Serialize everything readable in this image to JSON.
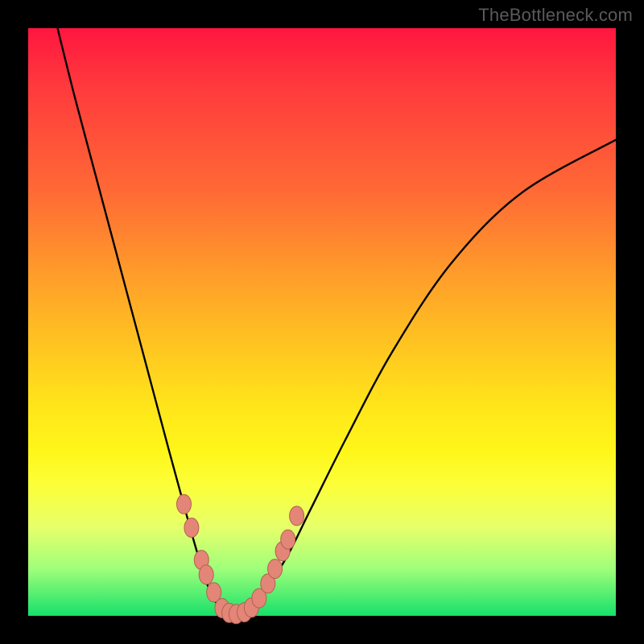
{
  "watermark": "TheBottleneck.com",
  "colors": {
    "frame_bg": "#000000",
    "curve_stroke": "#000000",
    "marker_fill": "#e38677",
    "marker_stroke": "#b45f52"
  },
  "chart_data": {
    "type": "line",
    "title": "",
    "xlabel": "",
    "ylabel": "",
    "xlim": [
      0,
      100
    ],
    "ylim": [
      0,
      100
    ],
    "series": [
      {
        "name": "bottleneck-curve",
        "x": [
          5,
          8,
          12,
          16,
          20,
          24,
          27,
          29,
          31,
          33,
          35,
          37,
          40,
          44,
          48,
          54,
          62,
          72,
          84,
          100
        ],
        "y": [
          100,
          88,
          73,
          58,
          43,
          28,
          17,
          10,
          4,
          1,
          0,
          1,
          4,
          10,
          18,
          30,
          45,
          60,
          72,
          81
        ]
      }
    ],
    "markers": {
      "name": "highlighted-points",
      "x": [
        26.5,
        27.8,
        29.5,
        30.3,
        31.6,
        33.0,
        34.2,
        35.4,
        36.8,
        38.0,
        39.3,
        40.8,
        42.0,
        43.3,
        44.2,
        45.7
      ],
      "y": [
        19.0,
        15.0,
        9.5,
        7.0,
        4.0,
        1.3,
        0.5,
        0.3,
        0.6,
        1.4,
        3.0,
        5.5,
        8.0,
        11.0,
        13.0,
        17.0
      ]
    },
    "background_gradient": {
      "top": "#ff163f",
      "mid": "#ffe71a",
      "bottom": "#16e06a"
    }
  }
}
